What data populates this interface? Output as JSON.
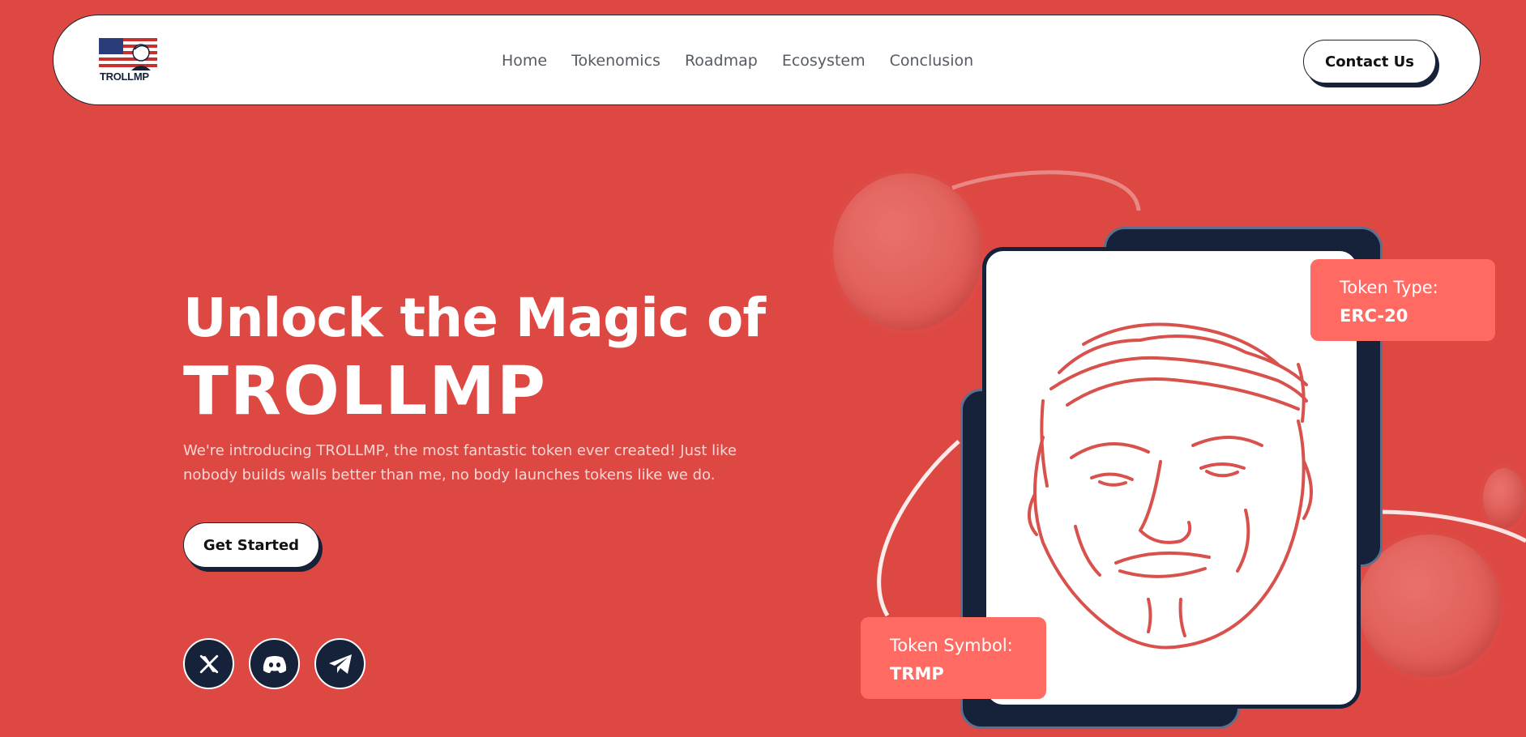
{
  "brand": {
    "logo_text": "TROLLMP"
  },
  "nav": {
    "links": [
      "Home",
      "Tokenomics",
      "Roadmap",
      "Ecosystem",
      "Conclusion"
    ],
    "contact_label": "Contact Us"
  },
  "hero": {
    "title_line1": "Unlock the Magic of",
    "title_line2": "TROLLMP",
    "description": "We're introducing TROLLMP, the most fantastic token ever created! Just like nobody builds walls better than me, no body launches tokens like we do.",
    "cta_label": "Get Started",
    "socials": [
      "x-icon",
      "discord-icon",
      "telegram-icon"
    ]
  },
  "token_type": {
    "label": "Token Type:",
    "value": "ERC-20"
  },
  "token_symbol": {
    "label": "Token Symbol:",
    "value": "TRMP"
  },
  "colors": {
    "background": "#DE4843",
    "navy": "#16213a",
    "info_box": "#FF6B63",
    "illustration_line": "#D9514C"
  }
}
